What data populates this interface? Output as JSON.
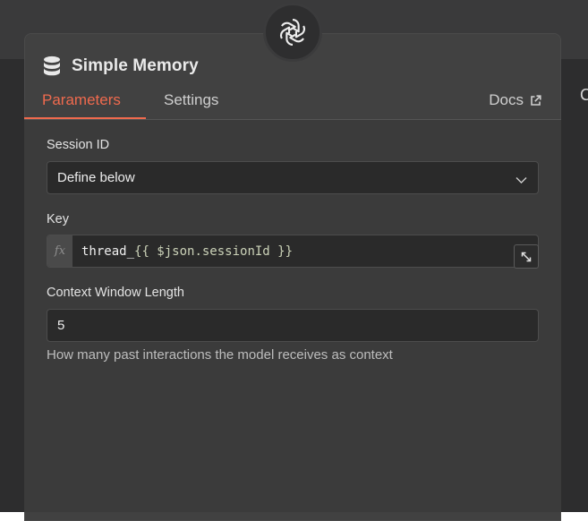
{
  "background": {
    "right_text": "C"
  },
  "node": {
    "title": "Simple Memory",
    "badge_icon": "openai-logo-icon",
    "title_icon": "database-icon"
  },
  "tabs": {
    "parameters": "Parameters",
    "settings": "Settings",
    "docs": "Docs",
    "active": "parameters"
  },
  "fields": {
    "session_id": {
      "label": "Session ID",
      "value": "Define below"
    },
    "key": {
      "label": "Key",
      "fx": "fx",
      "value_plain": "thread_",
      "value_expression": "{{ $json.sessionId }}"
    },
    "context_window": {
      "label": "Context Window Length",
      "value": "5",
      "hint": "How many past interactions the model receives as context"
    }
  },
  "colors": {
    "accent": "#ef6a4e",
    "panel": "#414141",
    "content": "#3b3b3b",
    "input_bg": "#2a2a2a"
  }
}
